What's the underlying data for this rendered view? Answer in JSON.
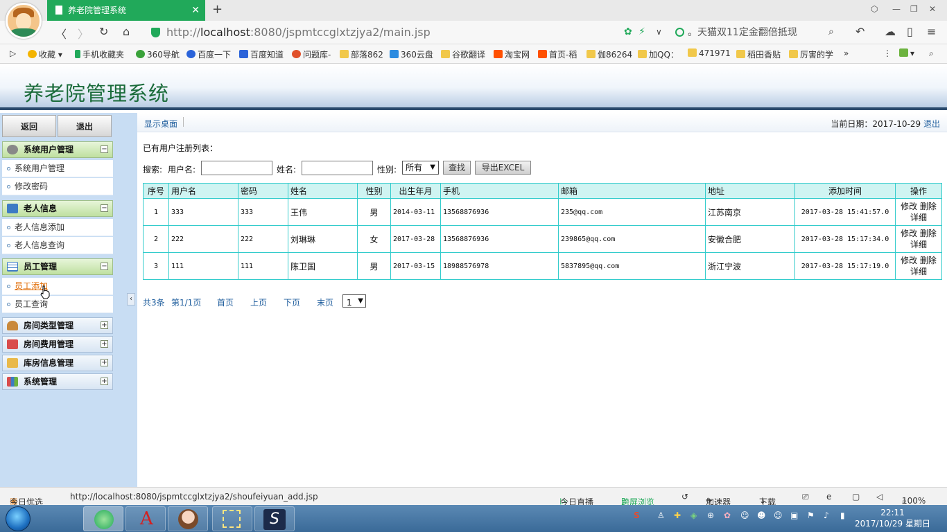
{
  "browser": {
    "tab_title": "养老院管理系统",
    "url_prefix": "http://",
    "url_host": "localhost",
    "url_rest": ":8080/jspmtccglxtzjya2/main.jsp",
    "search_placeholder": "。天猫双11定金翻倍抵现",
    "bookmarks": [
      "收藏",
      "手机收藏夹",
      "360导航",
      "百度一下",
      "百度知道",
      "问题库-",
      "部落862",
      "360云盘",
      "谷歌翻译",
      "淘宝网",
      "首页-稻",
      "伽86264",
      "加QQ：",
      "471971",
      "稻田香贴",
      "厉害的学"
    ]
  },
  "app": {
    "title": "养老院管理系统"
  },
  "sidebar": {
    "back_label": "返回",
    "logout_label": "退出",
    "groups": [
      {
        "label": "系统用户管理",
        "expanded": true,
        "items": [
          "系统用户管理",
          "修改密码"
        ]
      },
      {
        "label": "老人信息",
        "expanded": true,
        "items": [
          "老人信息添加",
          "老人信息查询"
        ]
      },
      {
        "label": "员工管理",
        "expanded": true,
        "items": [
          "员工添加",
          "员工查询"
        ]
      },
      {
        "label": "房间类型管理",
        "expanded": false,
        "items": []
      },
      {
        "label": "房间费用管理",
        "expanded": false,
        "items": []
      },
      {
        "label": "库房信息管理",
        "expanded": false,
        "items": []
      },
      {
        "label": "系统管理",
        "expanded": false,
        "items": []
      }
    ]
  },
  "main": {
    "desktop_link": "显示桌面",
    "date_label": "当前日期：2017-10-29",
    "logout_link": "退出",
    "list_title": "已有用户注册列表：",
    "search": {
      "label": "搜索:",
      "username_label": "用户名:",
      "name_label": "姓名:",
      "gender_label": "性别:",
      "gender_value": "所有",
      "find_button": "查找",
      "export_button": "导出EXCEL"
    },
    "table": {
      "headers": [
        "序号",
        "用户名",
        "密码",
        "姓名",
        "性别",
        "出生年月",
        "手机",
        "邮箱",
        "地址",
        "添加时间",
        "操作"
      ],
      "rows": [
        {
          "no": "1",
          "username": "333",
          "password": "333",
          "name": "王伟",
          "gender": "男",
          "birth": "2014-03-11",
          "phone": "13568876936",
          "email": "235@qq.com",
          "address": "江苏南京",
          "added": "2017-03-28 15:41:57.0",
          "edit": "修改",
          "delete": "删除",
          "detail": "详细"
        },
        {
          "no": "2",
          "username": "222",
          "password": "222",
          "name": "刘琳琳",
          "gender": "女",
          "birth": "2017-03-28",
          "phone": "13568876936",
          "email": "239865@qq.com",
          "address": "安徽合肥",
          "added": "2017-03-28 15:17:34.0",
          "edit": "修改",
          "delete": "删除",
          "detail": "详细"
        },
        {
          "no": "3",
          "username": "111",
          "password": "111",
          "name": "陈卫国",
          "gender": "男",
          "birth": "2017-03-15",
          "phone": "18988576978",
          "email": "5837895@qq.com",
          "address": "浙江宁波",
          "added": "2017-03-28 15:17:19.0",
          "edit": "修改",
          "delete": "删除",
          "detail": "详细"
        }
      ]
    },
    "pager": {
      "total": "共3条",
      "page": "第1/1页",
      "first": "首页",
      "prev": "上页",
      "next": "下页",
      "last": "末页",
      "select_value": "1"
    }
  },
  "statusbar": {
    "today_pick": "今日优选",
    "hover_url": "http://localhost:8080/jspmtccglxtzjya2/shoufeiyuan_add.jsp",
    "live": "今日直播",
    "cross_screen": "跨屏浏览",
    "accelerator": "加速器",
    "download": "下载",
    "zoom": "100%"
  },
  "taskbar": {
    "time": "22:11",
    "date": "2017/10/29 星期日"
  },
  "colors": {
    "tab_green": "#21a95a",
    "title_green": "#1a6b3a",
    "table_border": "#33cccc",
    "table_header_bg": "#cff4f2",
    "link_blue": "#215f9e",
    "sidebar_bg": "#c8ddf3"
  }
}
